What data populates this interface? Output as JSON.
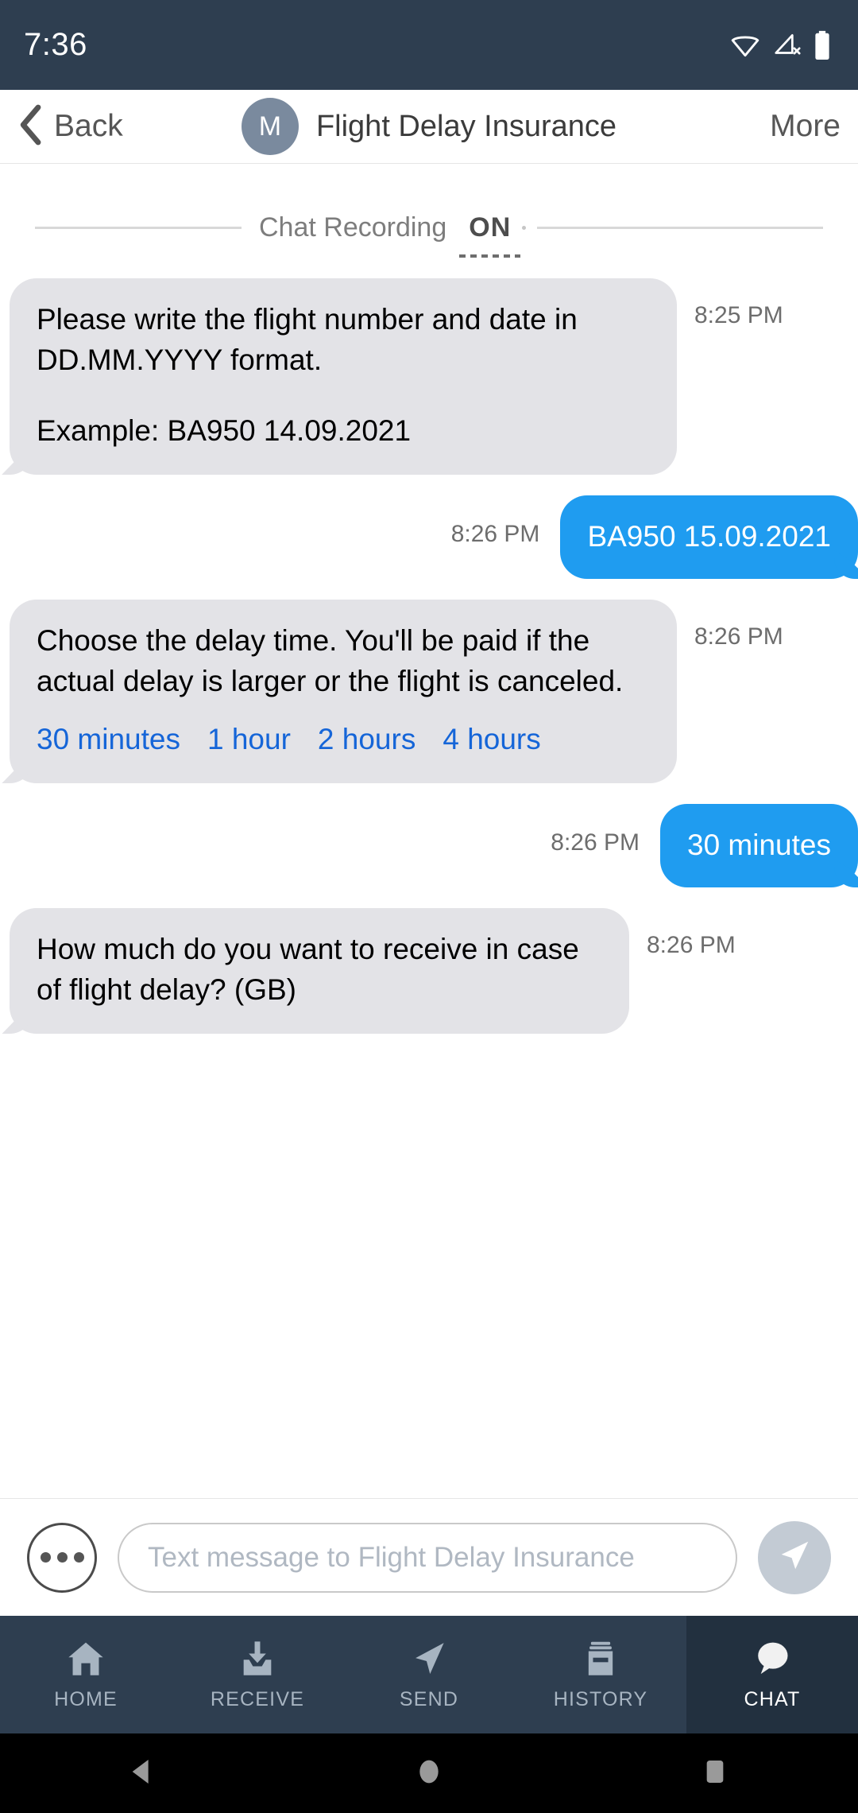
{
  "status_bar": {
    "time": "7:36",
    "icons": [
      "wifi-icon",
      "signal-off-icon",
      "battery-full-icon"
    ],
    "background": "#2e3e50"
  },
  "header": {
    "back_label": "Back",
    "avatar_initial": "M",
    "title": "Flight Delay Insurance",
    "more_label": "More",
    "avatar_color": "#7a8a9e"
  },
  "chat": {
    "recording_divider": {
      "label": "Chat Recording",
      "state": "ON"
    },
    "messages": [
      {
        "direction": "in",
        "line1": "Please write the flight number and date in DD.MM.YYYY format.",
        "line2": "Example: BA950 14.09.2021",
        "time": "8:25 PM"
      },
      {
        "direction": "out",
        "text": "BA950 15.09.2021",
        "time": "8:26 PM"
      },
      {
        "direction": "in",
        "line1": "Choose the delay time. You'll be paid if the actual delay is larger or the flight is canceled.",
        "time": "8:26 PM",
        "quick_replies": [
          "30 minutes",
          "1 hour",
          "2 hours",
          "4 hours"
        ]
      },
      {
        "direction": "out",
        "text": "30 minutes",
        "time": "8:26 PM"
      },
      {
        "direction": "in",
        "line1": "How much do you want to receive in case of flight delay? (GB)",
        "time": "8:26 PM"
      }
    ],
    "bubble_colors": {
      "incoming": "#e3e3e7",
      "outgoing": "#1f9cf0",
      "link": "#1565d8"
    }
  },
  "input_bar": {
    "more_actions_icon": "ellipsis-icon",
    "placeholder": "Text message to Flight Delay Insurance",
    "value": "",
    "send_icon": "send-paper-plane-icon"
  },
  "tab_bar": {
    "active": "CHAT",
    "tabs": [
      {
        "label": "HOME",
        "icon": "home-icon"
      },
      {
        "label": "RECEIVE",
        "icon": "download-tray-icon"
      },
      {
        "label": "SEND",
        "icon": "paper-plane-icon"
      },
      {
        "label": "HISTORY",
        "icon": "archive-box-icon"
      },
      {
        "label": "CHAT",
        "icon": "speech-bubble-icon"
      }
    ],
    "background": "#2e3e50",
    "active_background": "#22303f"
  },
  "android_nav": {
    "buttons": [
      "back-triangle-icon",
      "home-circle-icon",
      "recents-square-icon"
    ]
  }
}
